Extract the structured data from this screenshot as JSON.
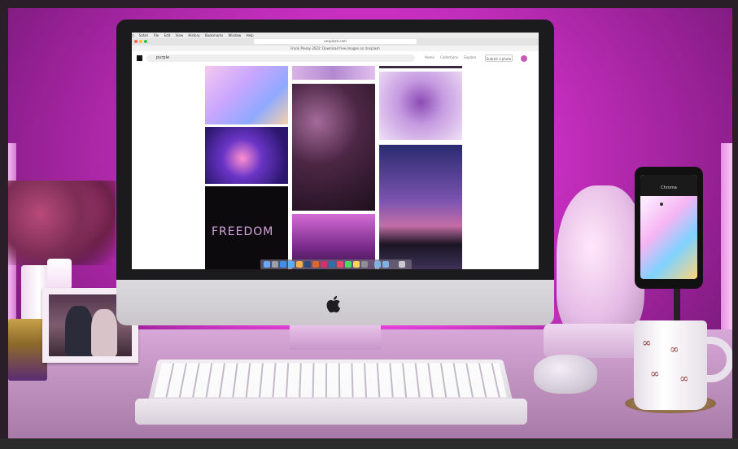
{
  "scene": {
    "description_colors": {
      "backlight": "#e23bd6",
      "desk": "#c89ac8",
      "imac_chin": "#dcdadf",
      "screen_bg": "#ffffff"
    }
  },
  "screen": {
    "menubar_items": [
      "Safari",
      "File",
      "Edit",
      "View",
      "History",
      "Bookmarks",
      "Window",
      "Help"
    ],
    "url": "unsplash.com",
    "banner_text": "Frank Pinsky 2022: Download free images on Unsplash",
    "search_value": "purple",
    "nav_items": [
      "Home",
      "Collections",
      "Explore"
    ],
    "submit_label": "Submit a photo"
  },
  "phone": {
    "app_title": "Chroma"
  },
  "icons": {
    "apple_logo": "apple-icon",
    "search": "search-icon"
  }
}
